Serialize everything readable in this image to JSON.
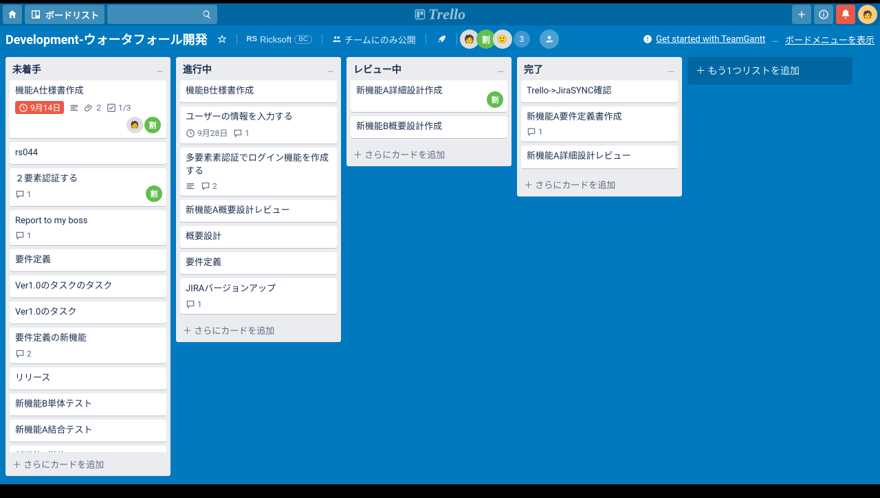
{
  "topbar": {
    "boards_btn": "ボードリスト",
    "logo": "Trello"
  },
  "boardbar": {
    "title": "Development-ウォータフォール開発",
    "team": "Ricksoft",
    "team_badge": "BC",
    "visibility": "チームにのみ公開",
    "member_count": "3",
    "teamgantt": "Get started with TeamGantt",
    "menu": "ボードメニューを表示"
  },
  "add_list": "もう1つリストを追加",
  "add_card": "さらにカードを追加",
  "lists": [
    {
      "title": "未着手",
      "cards": [
        {
          "title": "機能A仕様書作成",
          "due": "9月14日",
          "due_red": true,
          "desc": true,
          "attach": "2",
          "checklist": "1/3",
          "members": [
            "face",
            "green"
          ]
        },
        {
          "title": "rs044"
        },
        {
          "title": "２要素認証する",
          "comments": "1",
          "member_corner": "green"
        },
        {
          "title": "Report to my boss",
          "comments": "1"
        },
        {
          "title": "要件定義"
        },
        {
          "title": "Ver1.0のタスクのタスク"
        },
        {
          "title": "Ver1.0のタスク"
        },
        {
          "title": "要件定義の新機能",
          "comments": "2"
        },
        {
          "title": "リリース"
        },
        {
          "title": "新機能B単体テスト"
        },
        {
          "title": "新機能A結合テスト"
        },
        {
          "title": "新機能A単体テスト"
        }
      ]
    },
    {
      "title": "進行中",
      "cards": [
        {
          "title": "機能B仕様書作成"
        },
        {
          "title": "ユーザーの情報を入力する",
          "due": "9月28日",
          "comments": "1"
        },
        {
          "title": "多要素素認証でログイン機能を作成する",
          "desc": true,
          "comments": "2"
        },
        {
          "title": "新機能A概要設計レビュー"
        },
        {
          "title": "概要設計"
        },
        {
          "title": "要件定義"
        },
        {
          "title": "JIRAバージョンアップ",
          "comments": "1"
        }
      ]
    },
    {
      "title": "レビュー中",
      "cards": [
        {
          "title": "新機能A詳細設計作成",
          "member_corner": "green"
        },
        {
          "title": "新機能B概要設計作成"
        }
      ]
    },
    {
      "title": "完了",
      "cards": [
        {
          "title": "Trello->JiraSYNC確認"
        },
        {
          "title": "新機能A要件定義書作成",
          "comments": "1"
        },
        {
          "title": "新機能A詳細設計レビュー"
        }
      ]
    }
  ]
}
